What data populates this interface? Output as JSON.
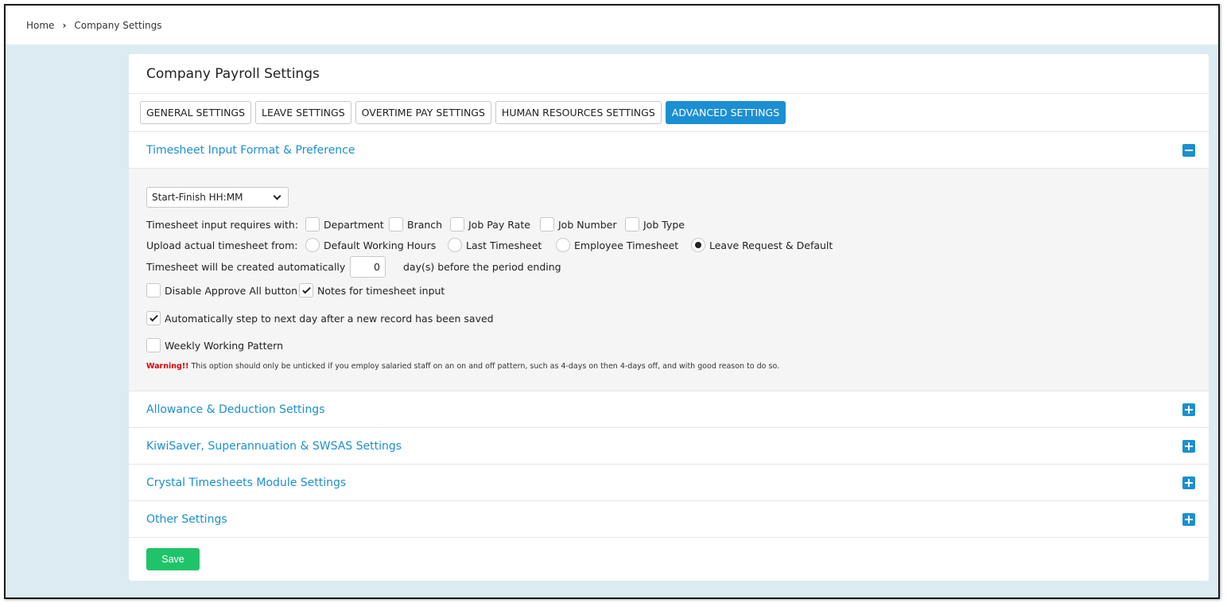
{
  "breadcrumb": {
    "home": "Home",
    "current": "Company Settings"
  },
  "page_title": "Company Payroll Settings",
  "tabs": [
    {
      "label": "GENERAL SETTINGS",
      "active": false
    },
    {
      "label": "LEAVE SETTINGS",
      "active": false
    },
    {
      "label": "OVERTIME PAY SETTINGS",
      "active": false
    },
    {
      "label": "HUMAN RESOURCES SETTINGS",
      "active": false
    },
    {
      "label": "ADVANCED SETTINGS",
      "active": true
    }
  ],
  "timesheet_section": {
    "title": "Timesheet Input Format & Preference",
    "format_select": "Start-Finish HH:MM",
    "requires_label": "Timesheet input requires with:",
    "requires_options": [
      {
        "label": "Department",
        "checked": false
      },
      {
        "label": "Branch",
        "checked": false
      },
      {
        "label": "Job Pay Rate",
        "checked": false
      },
      {
        "label": "Job Number",
        "checked": false
      },
      {
        "label": "Job Type",
        "checked": false
      }
    ],
    "upload_label": "Upload actual timesheet from:",
    "upload_options": [
      {
        "label": "Default Working Hours",
        "selected": false
      },
      {
        "label": "Last Timesheet",
        "selected": false
      },
      {
        "label": "Employee Timesheet",
        "selected": false
      },
      {
        "label": "Leave Request & Default",
        "selected": true
      }
    ],
    "auto_create_label": "Timesheet will be created automatically",
    "auto_create_days": "0",
    "auto_create_suffix": "day(s) before the period ending",
    "disable_approve_all": {
      "label": "Disable Approve All button",
      "checked": false
    },
    "notes_input": {
      "label": "Notes for timesheet input",
      "checked": true
    },
    "auto_step": {
      "label": "Automatically step to next day after a new record has been saved",
      "checked": true
    },
    "weekly_pattern": {
      "label": "Weekly Working Pattern",
      "checked": false
    },
    "warning_prefix": "Warning!!",
    "warning_text": " This option should only be unticked if you employ salaried staff on an on and off pattern, such as 4-days on then 4-days off, and with good reason to do so."
  },
  "collapsed_sections": [
    {
      "title": "Allowance & Deduction Settings"
    },
    {
      "title": "KiwiSaver, Superannuation & SWSAS Settings"
    },
    {
      "title": "Crystal Timesheets Module Settings"
    },
    {
      "title": "Other Settings"
    }
  ],
  "save_label": "Save",
  "colors": {
    "accent": "#1b8fd2",
    "save": "#1fc46a",
    "warning": "#e00000",
    "background": "#dcebf2"
  },
  "icons": {
    "breadcrumb_separator": "chevron-right-icon",
    "expanded": "minus-square-icon",
    "collapsed": "plus-square-icon"
  }
}
